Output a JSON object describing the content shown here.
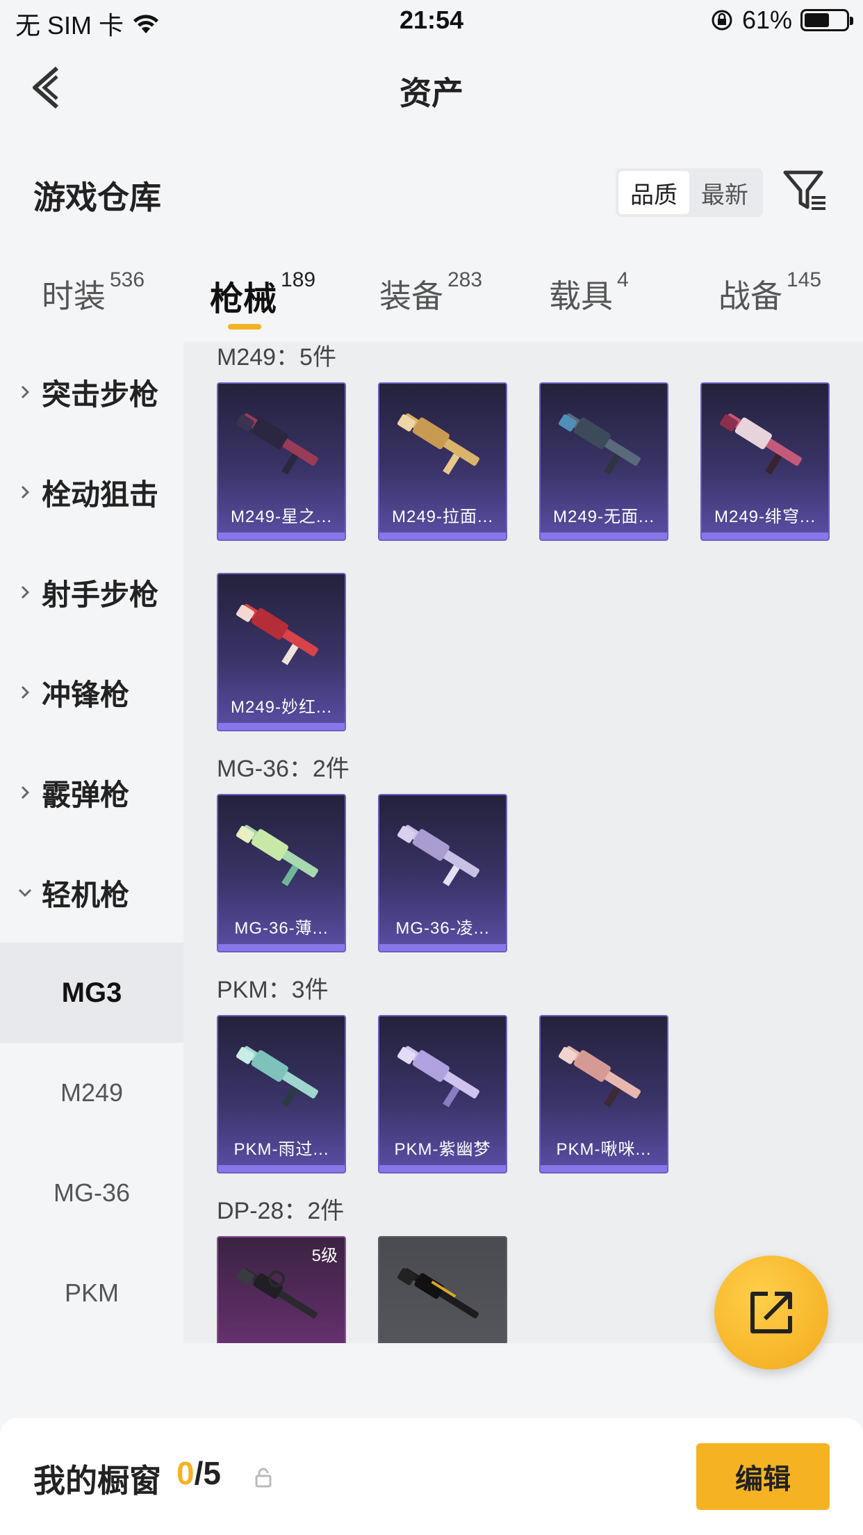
{
  "status_bar": {
    "carrier": "无 SIM 卡",
    "time": "21:54",
    "battery_percent": "61%",
    "battery_level": 0.61
  },
  "nav": {
    "title": "资产"
  },
  "warehouse": {
    "title": "游戏仓库",
    "sort_options": [
      {
        "label": "品质",
        "active": true
      },
      {
        "label": "最新",
        "active": false
      }
    ]
  },
  "tabs": [
    {
      "label": "时装",
      "count": "536",
      "active": false
    },
    {
      "label": "枪械",
      "count": "189",
      "active": true
    },
    {
      "label": "装备",
      "count": "283",
      "active": false
    },
    {
      "label": "载具",
      "count": "4",
      "active": false
    },
    {
      "label": "战备",
      "count": "145",
      "active": false
    }
  ],
  "sidebar": {
    "categories": [
      "突击步枪",
      "栓动狙击",
      "射手步枪",
      "冲锋枪",
      "霰弹枪",
      "轻机枪"
    ],
    "subitems": [
      "MG3",
      "M249",
      "MG-36",
      "PKM"
    ],
    "active_subitem": "MG3"
  },
  "groups": [
    {
      "title": "M249：5件",
      "items": [
        {
          "name": "M249-星之..."
        },
        {
          "name": "M249-拉面..."
        },
        {
          "name": "M249-无面..."
        },
        {
          "name": "M249-绯穹..."
        },
        {
          "name": "M249-妙红..."
        }
      ]
    },
    {
      "title": "MG-36：2件",
      "items": [
        {
          "name": "MG-36-薄..."
        },
        {
          "name": "MG-36-凌..."
        }
      ]
    },
    {
      "title": "PKM：3件",
      "items": [
        {
          "name": "PKM-雨过..."
        },
        {
          "name": "PKM-紫幽梦"
        },
        {
          "name": "PKM-啾咪..."
        }
      ]
    },
    {
      "title": "DP-28：2件",
      "items": [
        {
          "name": "",
          "level": "5级"
        },
        {
          "name": ""
        }
      ]
    }
  ],
  "bottom": {
    "showcase_label": "我的橱窗",
    "showcase_current": "0",
    "showcase_total": "/5",
    "edit_label": "编辑"
  },
  "colors": {
    "accent": "#f5b323",
    "card_purple": "#5b4ea6"
  }
}
